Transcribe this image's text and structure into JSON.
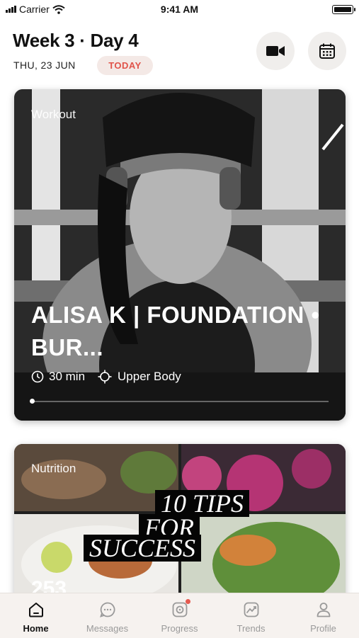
{
  "status": {
    "carrier": "Carrier",
    "time": "9:41 AM"
  },
  "header": {
    "title": "Week 3 · Day 4",
    "date": "THU, 23 JUN",
    "today_label": "TODAY"
  },
  "workout_card": {
    "label": "Workout",
    "title": "ALISA K | FOUNDATION • BUR...",
    "duration": "30 min",
    "focus": "Upper Body",
    "progress": 0.0
  },
  "nutrition_card": {
    "label": "Nutrition",
    "tips_line1": "10 TIPS",
    "tips_line2": "FOR",
    "tips_line3": "SUCCESS",
    "partial_number": "253"
  },
  "tabs": [
    {
      "label": "Home",
      "icon": "home-icon",
      "active": true
    },
    {
      "label": "Messages",
      "icon": "messages-icon",
      "active": false
    },
    {
      "label": "Progress",
      "icon": "progress-icon",
      "active": false
    },
    {
      "label": "Trends",
      "icon": "trends-icon",
      "active": false
    },
    {
      "label": "Profile",
      "icon": "profile-icon",
      "active": false
    }
  ],
  "colors": {
    "accent": "#e0534a",
    "today_bg": "#f4e9e6",
    "tab_bg": "#f6f2ef"
  }
}
